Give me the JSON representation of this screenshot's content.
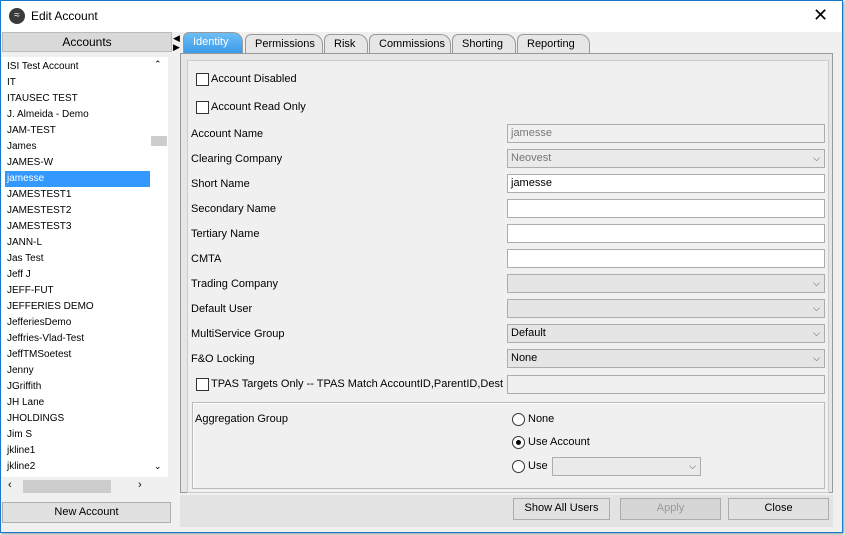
{
  "window": {
    "title": "Edit Account",
    "close_icon": "close-icon"
  },
  "accounts": {
    "header": "Accounts",
    "items": [
      "ISI Test Account",
      "IT",
      "ITAUSEC TEST",
      "J. Almeida - Demo",
      "JAM-TEST",
      "James",
      "JAMES-W",
      "jamesse",
      "JAMESTEST1",
      "JAMESTEST2",
      "JAMESTEST3",
      "JANN-L",
      "Jas Test",
      "Jeff J",
      "JEFF-FUT",
      "JEFFERIES DEMO",
      "JefferiesDemo",
      "Jeffries-Vlad-Test",
      "JeffTMSoetest",
      "Jenny",
      "JGriffith",
      "JH Lane",
      "JHOLDINGS",
      "Jim S",
      "jkline1",
      "jkline2"
    ],
    "selected": "jamesse",
    "new_account": "New Account"
  },
  "tabs": [
    "Identity",
    "Permissions",
    "Risk",
    "Commissions",
    "Shorting",
    "Reporting"
  ],
  "active_tab": "Identity",
  "identity": {
    "account_disabled": "Account Disabled",
    "account_read_only": "Account Read Only",
    "fields": [
      {
        "label": "Account Name",
        "value": "jamesse",
        "kind": "readonly"
      },
      {
        "label": "Clearing Company",
        "value": "Neovest",
        "kind": "combo-disabled"
      },
      {
        "label": "Short Name",
        "value": "jamesse",
        "kind": "text"
      },
      {
        "label": "Secondary Name",
        "value": "",
        "kind": "text"
      },
      {
        "label": "Tertiary Name",
        "value": "",
        "kind": "text"
      },
      {
        "label": "CMTA",
        "value": "",
        "kind": "text"
      },
      {
        "label": "Trading Company",
        "value": "",
        "kind": "combo"
      },
      {
        "label": "Default User",
        "value": "",
        "kind": "combo"
      },
      {
        "label": "MultiService Group",
        "value": "Default",
        "kind": "combo"
      },
      {
        "label": "F&O Locking",
        "value": "None",
        "kind": "combo"
      }
    ],
    "tpas_label": "TPAS Targets Only -- TPAS Match AccountID,ParentID,Dest",
    "tpas_value": "",
    "aggregation": {
      "label": "Aggregation Group",
      "options": [
        "None",
        "Use Account",
        "Use"
      ],
      "selected": "Use Account",
      "use_value": ""
    }
  },
  "buttons": {
    "show_all_users": "Show All Users",
    "apply": "Apply",
    "close": "Close"
  }
}
